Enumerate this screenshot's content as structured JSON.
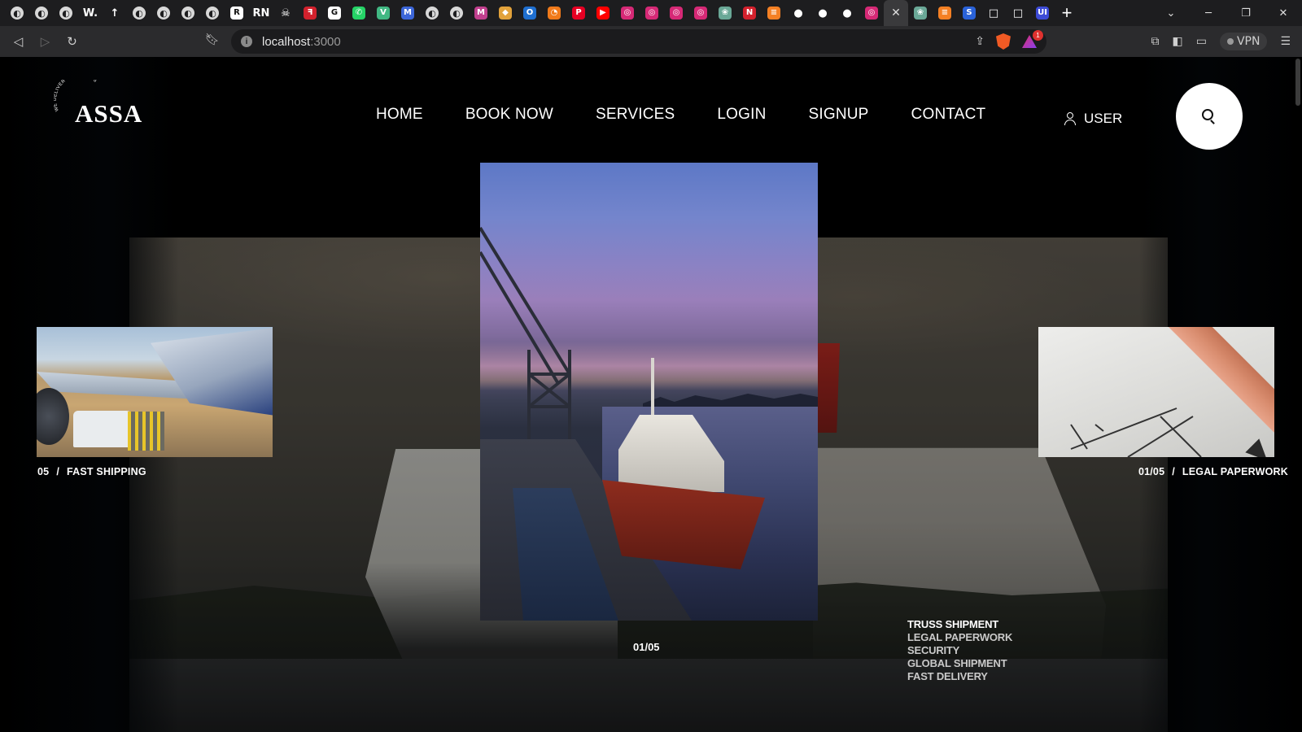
{
  "browser": {
    "tabs": [
      {
        "icon": "globe-icon",
        "glyph": "",
        "bg": ""
      },
      {
        "icon": "globe-icon",
        "glyph": "",
        "bg": ""
      },
      {
        "icon": "globe-icon",
        "glyph": "",
        "bg": ""
      },
      {
        "icon": "w-icon",
        "glyph": "W.",
        "bg": ""
      },
      {
        "icon": "arrow-icon",
        "glyph": "↑",
        "bg": ""
      },
      {
        "icon": "globe-icon",
        "glyph": "",
        "bg": ""
      },
      {
        "icon": "globe-icon",
        "glyph": "",
        "bg": ""
      },
      {
        "icon": "globe-icon",
        "glyph": "",
        "bg": ""
      },
      {
        "icon": "globe-icon",
        "glyph": "",
        "bg": ""
      },
      {
        "icon": "r-icon",
        "glyph": "R",
        "bg": "#ffffff"
      },
      {
        "icon": "rn-icon",
        "glyph": "RN",
        "bg": ""
      },
      {
        "icon": "skull-icon",
        "glyph": "☠",
        "bg": ""
      },
      {
        "icon": "red-app-icon",
        "glyph": "ꟻ",
        "bg": "#d3212d"
      },
      {
        "icon": "google-icon",
        "glyph": "G",
        "bg": "#ffffff"
      },
      {
        "icon": "whatsapp-icon",
        "glyph": "✆",
        "bg": "#25d366"
      },
      {
        "icon": "vue-icon",
        "glyph": "V",
        "bg": "#41b883"
      },
      {
        "icon": "m-icon",
        "glyph": "M",
        "bg": "#3c66d8"
      },
      {
        "icon": "globe-icon",
        "glyph": "",
        "bg": ""
      },
      {
        "icon": "globe-icon",
        "glyph": "",
        "bg": ""
      },
      {
        "icon": "m-gradient-icon",
        "glyph": "M",
        "bg": "#c13f8e"
      },
      {
        "icon": "cube-icon",
        "glyph": "◆",
        "bg": "#e2a23b"
      },
      {
        "icon": "outlook-icon",
        "glyph": "O",
        "bg": "#1f6fd0"
      },
      {
        "icon": "blender-icon",
        "glyph": "◔",
        "bg": "#f07a1a"
      },
      {
        "icon": "pinterest-icon",
        "glyph": "P",
        "bg": "#e60023"
      },
      {
        "icon": "youtube-icon",
        "glyph": "▶",
        "bg": "#ff0000"
      },
      {
        "icon": "instagram-icon",
        "glyph": "◎",
        "bg": "#d62976"
      },
      {
        "icon": "instagram-icon",
        "glyph": "◎",
        "bg": "#d62976"
      },
      {
        "icon": "instagram-icon",
        "glyph": "◎",
        "bg": "#d62976"
      },
      {
        "icon": "instagram-icon",
        "glyph": "◎",
        "bg": "#d62976"
      },
      {
        "icon": "chatgpt-icon",
        "glyph": "❀",
        "bg": "#6aa897"
      },
      {
        "icon": "notion-icon",
        "glyph": "N",
        "bg": "#d3212d"
      },
      {
        "icon": "stack-icon",
        "glyph": "≡",
        "bg": "#f48024"
      },
      {
        "icon": "github-icon",
        "glyph": "●",
        "bg": ""
      },
      {
        "icon": "github-icon",
        "glyph": "●",
        "bg": ""
      },
      {
        "icon": "github-icon",
        "glyph": "●",
        "bg": ""
      },
      {
        "icon": "instagram-icon",
        "glyph": "◎",
        "bg": "#d62976"
      },
      {
        "icon": "close-icon",
        "glyph": "✕",
        "bg": "",
        "active": true
      },
      {
        "icon": "chatgpt-icon",
        "glyph": "❀",
        "bg": "#6aa897"
      },
      {
        "icon": "stack-icon",
        "glyph": "≡",
        "bg": "#f48024"
      },
      {
        "icon": "swirl-icon",
        "glyph": "S",
        "bg": "#2a62d8"
      },
      {
        "icon": "square-icon",
        "glyph": "□",
        "bg": ""
      },
      {
        "icon": "square-icon",
        "glyph": "□",
        "bg": ""
      },
      {
        "icon": "ui-icon",
        "glyph": "UI",
        "bg": "#3d4bd6"
      }
    ],
    "new_tab_label": "+",
    "window_controls": [
      "⌄",
      "─",
      "❐",
      "✕"
    ],
    "url_host": "localhost",
    "url_port": ":3000",
    "vpn_label": "VPN",
    "rewards_badge": "1"
  },
  "site": {
    "logo_text": "ASSA",
    "logo_tagline": "WE DELIVER HAPPINESS",
    "nav": [
      "HOME",
      "BOOK NOW",
      "SERVICES",
      "LOGIN",
      "SIGNUP",
      "CONTACT"
    ],
    "user_label": "USER"
  },
  "slider": {
    "left_caption": {
      "index": "05",
      "separator": "/",
      "title": "FAST SHIPPING"
    },
    "right_caption": {
      "index": "01/05",
      "separator": "/",
      "title": "LEGAL PAPERWORK"
    },
    "counter": "01/05",
    "services": [
      {
        "label": "TRUSS SHIPMENT",
        "active": true
      },
      {
        "label": "LEGAL PAPERWORK",
        "active": false
      },
      {
        "label": "SECURITY",
        "active": false
      },
      {
        "label": "GLOBAL SHIPMENT",
        "active": false
      },
      {
        "label": "FAST DELIVERY",
        "active": false
      }
    ]
  }
}
